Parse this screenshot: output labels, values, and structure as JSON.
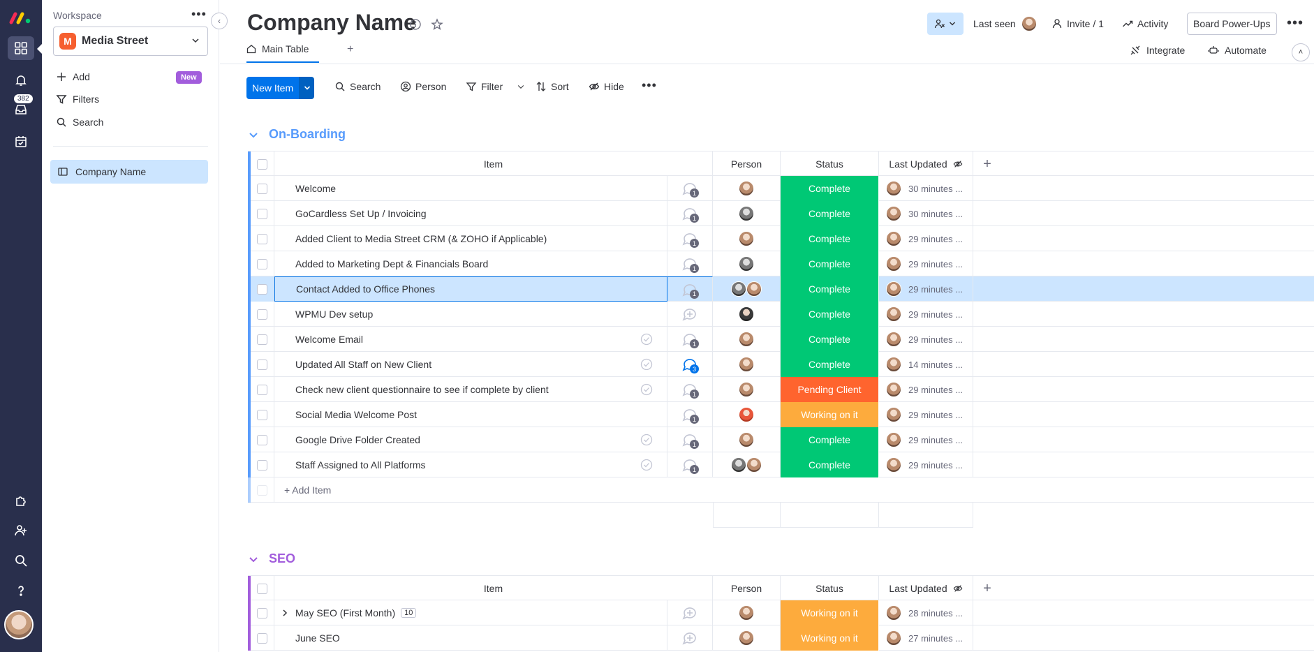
{
  "rail": {
    "inbox_badge": "382",
    "colors": {
      "bg": "#292f4c",
      "active": "#4b5172"
    }
  },
  "workspace": {
    "label": "Workspace",
    "name": "Media Street",
    "initial": "M",
    "add_label": "Add",
    "new_badge": "New",
    "filters_label": "Filters",
    "search_label": "Search",
    "board_name": "Company Name"
  },
  "header": {
    "title": "Company Name",
    "last_seen": "Last seen",
    "invite": "Invite / 1",
    "activity": "Activity",
    "powerups": "Board Power-Ups",
    "tab_main": "Main Table",
    "tab_add": "+",
    "integrate": "Integrate",
    "automate": "Automate"
  },
  "toolbar": {
    "new_item": "New Item",
    "search": "Search",
    "person": "Person",
    "filter": "Filter",
    "sort": "Sort",
    "hide": "Hide"
  },
  "columns": {
    "item": "Item",
    "person": "Person",
    "status": "Status",
    "last_updated": "Last Updated"
  },
  "status_colors": {
    "Complete": "#00c875",
    "Pending Client": "#ff642e",
    "Working on it": "#fdab3d"
  },
  "groups": [
    {
      "name": "On-Boarding",
      "color": "#579bfc",
      "add_item": "+ Add Item",
      "rows": [
        {
          "item": "Welcome",
          "upd_count": "1",
          "check": false,
          "persons": [
            "f"
          ],
          "status": "Complete",
          "last": "30 minutes ..."
        },
        {
          "item": "GoCardless Set Up / Invoicing",
          "upd_count": "1",
          "check": false,
          "persons": [
            "g"
          ],
          "status": "Complete",
          "last": "30 minutes ..."
        },
        {
          "item": "Added Client to Media Street CRM (& ZOHO if Applicable)",
          "upd_count": "1",
          "check": false,
          "persons": [
            "f"
          ],
          "status": "Complete",
          "last": "29 minutes ..."
        },
        {
          "item": "Added to Marketing Dept & Financials Board",
          "upd_count": "1",
          "check": false,
          "persons": [
            "g"
          ],
          "status": "Complete",
          "last": "29 minutes ..."
        },
        {
          "item": "Contact Added to Office Phones",
          "upd_count": "1",
          "check": false,
          "persons": [
            "g",
            "f"
          ],
          "status": "Complete",
          "last": "29 minutes ...",
          "highlight": true
        },
        {
          "item": "WPMU Dev setup",
          "upd_count": "",
          "check": false,
          "persons": [
            "d"
          ],
          "status": "Complete",
          "last": "29 minutes ..."
        },
        {
          "item": "Welcome Email",
          "upd_count": "1",
          "check": true,
          "persons": [
            "f"
          ],
          "status": "Complete",
          "last": "29 minutes ..."
        },
        {
          "item": "Updated All Staff on New Client",
          "upd_count": "3",
          "check": true,
          "persons": [
            "f"
          ],
          "status": "Complete",
          "last": "14 minutes ...",
          "blue": true
        },
        {
          "item": "Check new client questionnaire to see if complete by client",
          "upd_count": "1",
          "check": true,
          "persons": [
            "f"
          ],
          "status": "Pending Client",
          "last": "29 minutes ..."
        },
        {
          "item": "Social Media Welcome Post",
          "upd_count": "1",
          "check": false,
          "persons": [
            "r"
          ],
          "status": "Working on it",
          "last": "29 minutes ..."
        },
        {
          "item": "Google Drive Folder Created",
          "upd_count": "1",
          "check": true,
          "persons": [
            "f"
          ],
          "status": "Complete",
          "last": "29 minutes ..."
        },
        {
          "item": "Staff Assigned to All Platforms",
          "upd_count": "1",
          "check": true,
          "persons": [
            "g",
            "f"
          ],
          "status": "Complete",
          "last": "29 minutes ..."
        }
      ]
    },
    {
      "name": "SEO",
      "color": "#a25ddc",
      "rows": [
        {
          "item": "May SEO (First Month)",
          "subitems": "10",
          "upd_count": "",
          "check": false,
          "persons": [
            "f"
          ],
          "status": "Working on it",
          "last": "28 minutes ..."
        },
        {
          "item": "June SEO",
          "upd_count": "",
          "check": false,
          "persons": [
            "f"
          ],
          "status": "Working on it",
          "last": "27 minutes ..."
        }
      ]
    }
  ]
}
